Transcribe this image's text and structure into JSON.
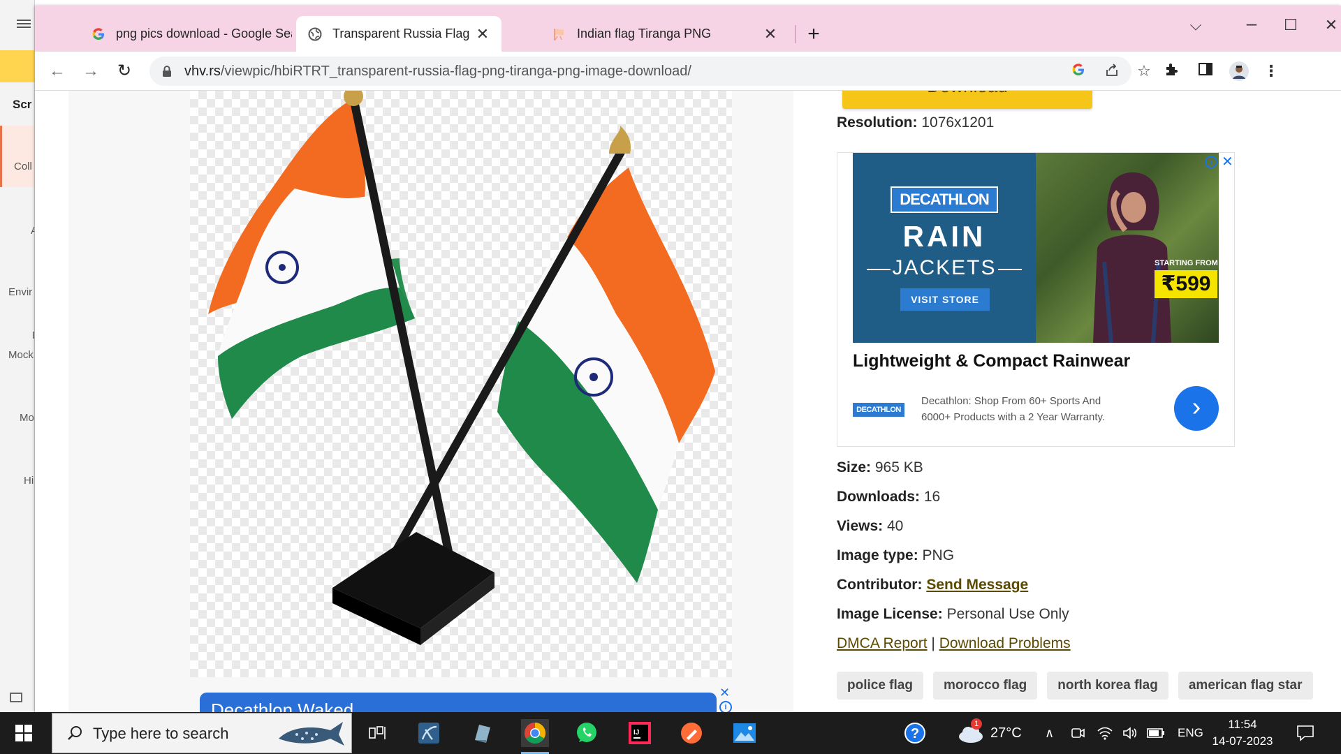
{
  "behind_app": {
    "labels": [
      "Scr",
      "Coll",
      "A",
      "Envir",
      "I",
      "Mock",
      "Mo",
      "Hi"
    ]
  },
  "browser": {
    "tabs": [
      {
        "title": "png pics download - Google Sea",
        "icon": "google-icon",
        "active": false
      },
      {
        "title": "Transparent Russia Flag Png - Tir",
        "icon": "globe-icon",
        "active": true
      },
      {
        "title": "Indian flag Tiranga PNG",
        "icon": "flag-site-icon",
        "active": false
      }
    ],
    "new_tab_label": "+",
    "url_host": "vhv.rs",
    "url_path": "/viewpic/hbiRTRT_transparent-russia-flag-png-tiranga-png-image-download/"
  },
  "page": {
    "download_label": "Download",
    "resolution_label": "Resolution:",
    "resolution_value": "1076x1201",
    "ad": {
      "brand": "DECATHLON",
      "rain": "RAIN",
      "jackets": "JACKETS",
      "visit": "VISIT STORE",
      "starting_from": "STARTING FROM",
      "price": "₹599",
      "headline": "Lightweight & Compact Rainwear",
      "logo_small": "DECATHLON",
      "description": "Decathlon: Shop From 60+ Sports And 6000+ Products with a 2 Year Warranty.",
      "arrow": "›",
      "info": "i",
      "close": "✕"
    },
    "size_label": "Size:",
    "size_value": "965 KB",
    "downloads_label": "Downloads:",
    "downloads_value": "16",
    "views_label": "Views:",
    "views_value": "40",
    "image_type_label": "Image type:",
    "image_type_value": "PNG",
    "contributor_label": "Contributor:",
    "contributor_link": "Send Message",
    "license_label": "Image License:",
    "license_value": "Personal Use Only",
    "dmca_link": "DMCA Report",
    "separator": "|",
    "problems_link": "Download Problems",
    "tags": [
      "police flag",
      "morocco flag",
      "north korea flag",
      "american flag star"
    ],
    "bottom_ad_text": "Decathlon Waked"
  },
  "taskbar": {
    "search_placeholder": "Type here to search",
    "weather_temp": "27°C",
    "weather_badge": "1",
    "language": "ENG",
    "time": "11:54",
    "date": "14-07-2023"
  },
  "colors": {
    "tabstrip": "#f7d4e5",
    "accent_yellow": "#f5c518",
    "link_olive": "#5b4a00",
    "decathlon_blue": "#2b7bd0"
  }
}
